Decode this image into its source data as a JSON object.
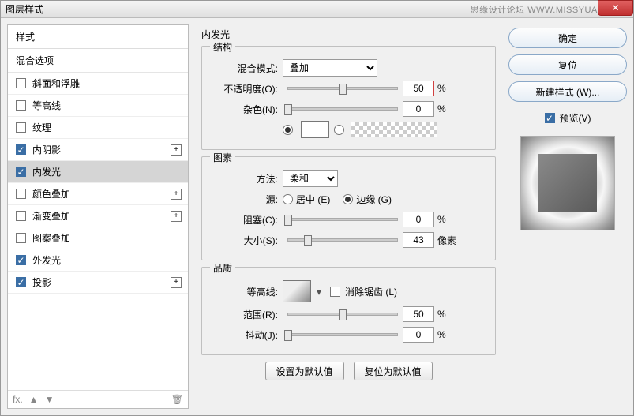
{
  "window": {
    "title": "图层样式",
    "watermark": "思缘设计论坛  WWW.MISSYUAN.COM"
  },
  "left": {
    "header": "样式",
    "sub": "混合选项",
    "items": [
      {
        "label": "斜面和浮雕",
        "checked": false,
        "plus": false
      },
      {
        "label": "等高线",
        "checked": false,
        "plus": false
      },
      {
        "label": "纹理",
        "checked": false,
        "plus": false
      },
      {
        "label": "内阴影",
        "checked": true,
        "plus": true
      },
      {
        "label": "内发光",
        "checked": true,
        "plus": false,
        "selected": true
      },
      {
        "label": "颜色叠加",
        "checked": false,
        "plus": true
      },
      {
        "label": "渐变叠加",
        "checked": false,
        "plus": true
      },
      {
        "label": "图案叠加",
        "checked": false,
        "plus": false
      },
      {
        "label": "外发光",
        "checked": true,
        "plus": false
      },
      {
        "label": "投影",
        "checked": true,
        "plus": true
      }
    ],
    "footer": {
      "fx": "fx.",
      "up": "▲",
      "down": "▼",
      "trash": "🗑"
    }
  },
  "center": {
    "title": "内发光",
    "structure": {
      "legend": "结构",
      "blend_label": "混合模式:",
      "blend_value": "叠加",
      "opacity_label": "不透明度(O):",
      "opacity_value": "50",
      "opacity_unit": "%",
      "noise_label": "杂色(N):",
      "noise_value": "0",
      "noise_unit": "%"
    },
    "elements": {
      "legend": "图素",
      "method_label": "方法:",
      "method_value": "柔和",
      "source_label": "源:",
      "center": "居中 (E)",
      "edge": "边缘 (G)",
      "choke_label": "阻塞(C):",
      "choke_value": "0",
      "choke_unit": "%",
      "size_label": "大小(S):",
      "size_value": "43",
      "size_unit": "像素"
    },
    "quality": {
      "legend": "品质",
      "contour_label": "等高线:",
      "antialias": "消除锯齿 (L)",
      "range_label": "范围(R):",
      "range_value": "50",
      "range_unit": "%",
      "jitter_label": "抖动(J):",
      "jitter_value": "0",
      "jitter_unit": "%"
    },
    "buttons": {
      "default": "设置为默认值",
      "reset": "复位为默认值"
    }
  },
  "right": {
    "ok": "确定",
    "cancel": "复位",
    "newstyle": "新建样式 (W)...",
    "preview_label": "预览(V)"
  }
}
